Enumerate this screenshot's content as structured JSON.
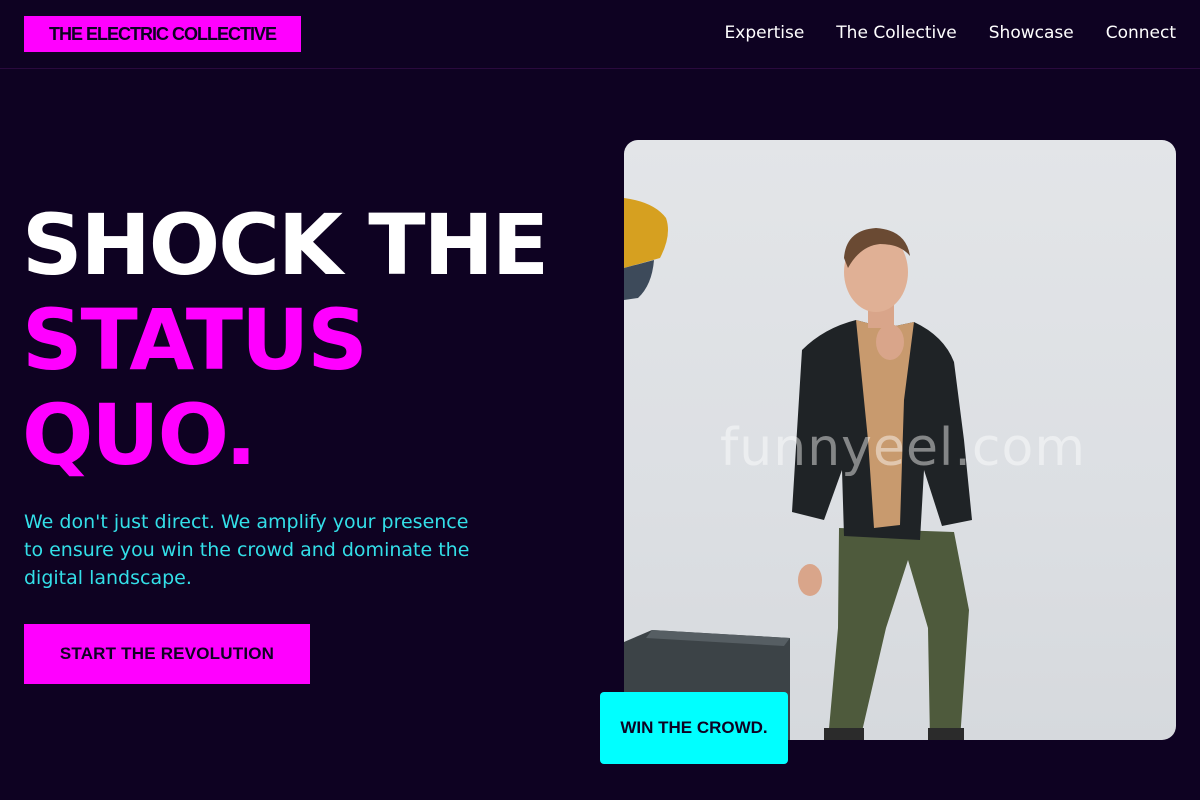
{
  "brand": {
    "logo_text": "THE ELECTRIC COLLECTIVE"
  },
  "nav": {
    "items": [
      "Expertise",
      "The Collective",
      "Showcase",
      "Connect"
    ]
  },
  "hero": {
    "headline_line1": "SHOCK THE",
    "headline_line2": "STATUS",
    "headline_line3": "QUO.",
    "subtext": "We don't just direct. We amplify your presence to ensure you win the crowd and dominate the digital landscape.",
    "cta_label": "START THE REVOLUTION",
    "badge_label": "WIN THE CROWD.",
    "watermark": "funnyeel.com",
    "image_alt": "Man in black blazer and green trousers standing in a studio"
  },
  "colors": {
    "background": "#0e0222",
    "accent_pink": "#ff00ff",
    "accent_cyan": "#00ffff",
    "subtext_cyan": "#33dfe8"
  }
}
